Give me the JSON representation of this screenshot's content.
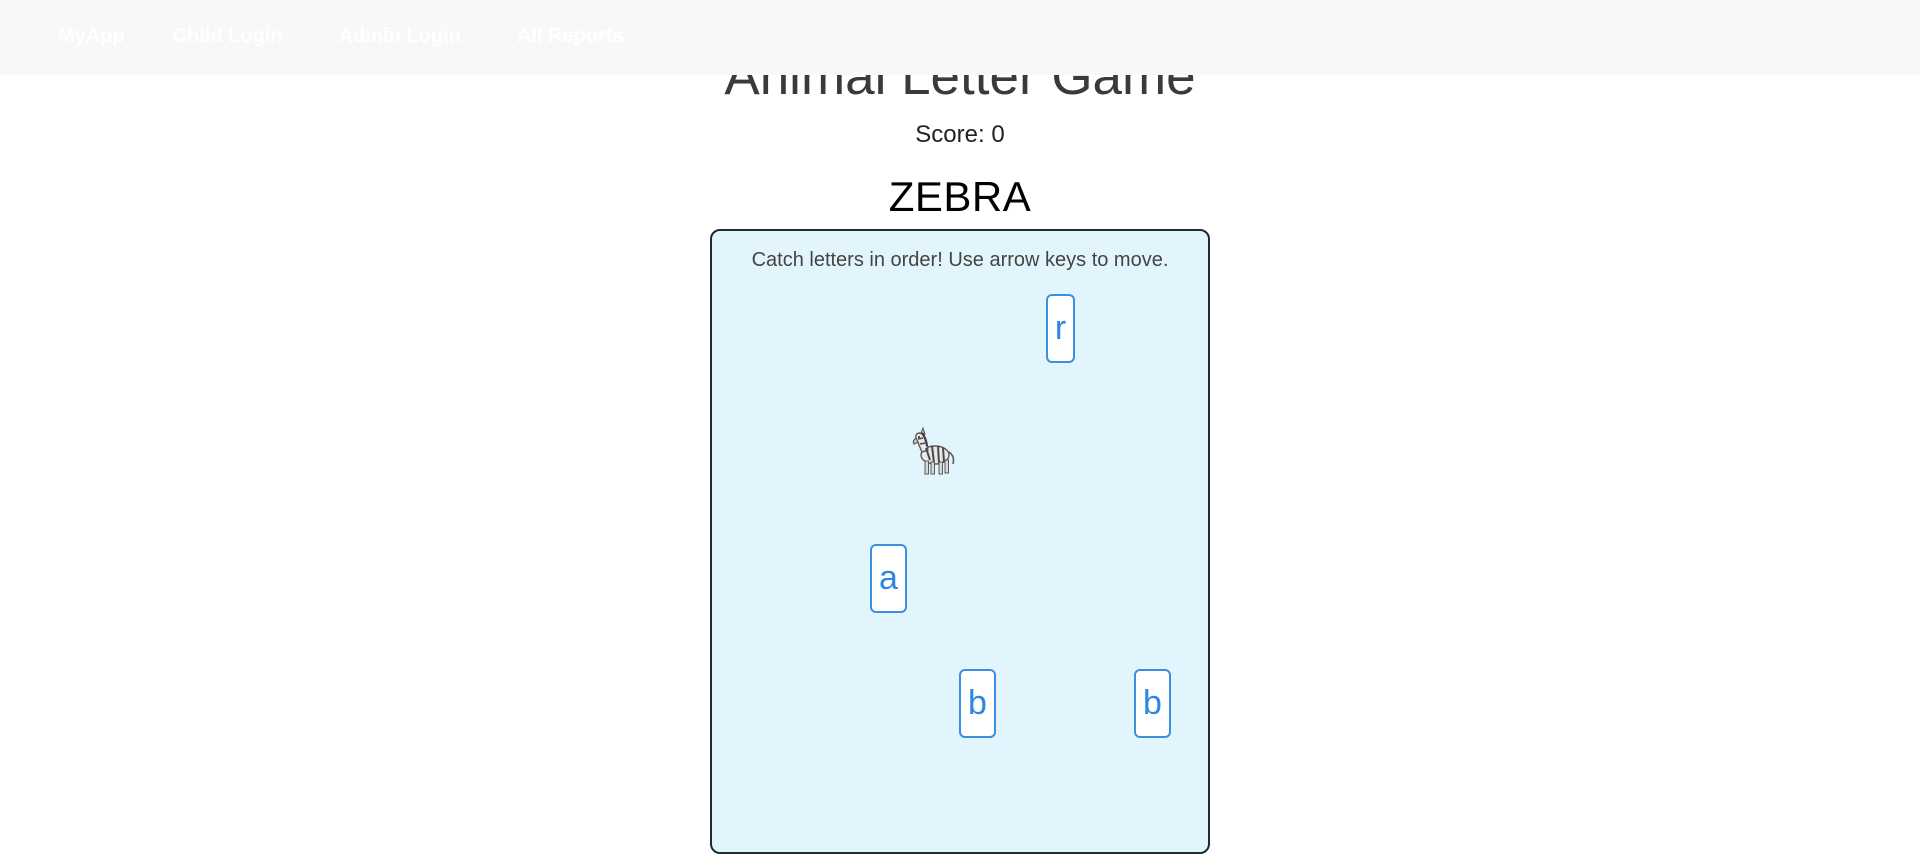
{
  "navbar": {
    "brand": "MyApp",
    "links": [
      "Child Login",
      "Admin Login",
      "All Reports"
    ]
  },
  "game": {
    "title": "Animal Letter Game",
    "score_text": "Score: 0",
    "target_word": "ZEBRA",
    "instructions": "Catch letters in order! Use arrow keys to move.",
    "player_icon": "zebra-icon",
    "letters": [
      "r",
      "a",
      "b",
      "b"
    ]
  },
  "colors": {
    "navbar_bg": "#f7f8f9",
    "board_bg": "#e3f5fc",
    "board_border": "#1f2a33",
    "tile_border": "#3a8fe0",
    "tile_text": "#2d86e0"
  }
}
